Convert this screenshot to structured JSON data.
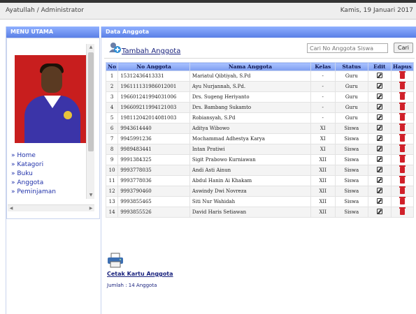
{
  "header": {
    "user": "Ayatullah / Administrator",
    "date": "Kamis, 19 Januari 2017"
  },
  "sidebar": {
    "title": "MENU UTAMA",
    "items": [
      {
        "label": "» Home"
      },
      {
        "label": "» Katagori"
      },
      {
        "label": "» Buku"
      },
      {
        "label": "» Anggota"
      },
      {
        "label": "» Peminjaman"
      }
    ]
  },
  "main": {
    "title": "Data Anggota",
    "add_label": "Tambah Anggota",
    "search": {
      "placeholder": "Cari No Anggota Siswa",
      "button": "Cari"
    },
    "columns": [
      "No",
      "No Anggota",
      "Nama Anggota",
      "Kelas",
      "Status",
      "Edit",
      "Hapus"
    ],
    "rows": [
      {
        "no": "1",
        "id": "15312436413331",
        "name": "Mariatul Qibtiyah, S.Pd",
        "kelas": "-",
        "status": "Guru"
      },
      {
        "no": "2",
        "id": "196111131986012001",
        "name": "Ayu Nurjannah, S.Pd.",
        "kelas": "-",
        "status": "Guru"
      },
      {
        "no": "3",
        "id": "196601241994031006",
        "name": "Drs. Sugeng Heriyanto",
        "kelas": "-",
        "status": "Guru"
      },
      {
        "no": "4",
        "id": "196609211994121003",
        "name": "Drs. Bambang Sukamto",
        "kelas": "-",
        "status": "Guru"
      },
      {
        "no": "5",
        "id": "198112042014081003",
        "name": "Robiansyah, S.Pd",
        "kelas": "-",
        "status": "Guru"
      },
      {
        "no": "6",
        "id": "9943614440",
        "name": "Aditya Wibowo",
        "kelas": "XI",
        "status": "Siswa"
      },
      {
        "no": "7",
        "id": "9945991236",
        "name": "Mochammad Adhestya Karya",
        "kelas": "XI",
        "status": "Siswa"
      },
      {
        "no": "8",
        "id": "9989483441",
        "name": "Intan Pratiwi",
        "kelas": "XI",
        "status": "Siswa"
      },
      {
        "no": "9",
        "id": "9991384325",
        "name": "Sigit Prabowo Kurniawan",
        "kelas": "XII",
        "status": "Siswa"
      },
      {
        "no": "10",
        "id": "9993778035",
        "name": "Andi Asti Ainun",
        "kelas": "XII",
        "status": "Siswa"
      },
      {
        "no": "11",
        "id": "9993778036",
        "name": "Abdul Hanin Ai Khakam",
        "kelas": "XII",
        "status": "Siswa"
      },
      {
        "no": "12",
        "id": "9993790460",
        "name": "Aswindy Dwi Novreza",
        "kelas": "XII",
        "status": "Siswa"
      },
      {
        "no": "13",
        "id": "9993855465",
        "name": "Siti Nur Wahidah",
        "kelas": "XII",
        "status": "Siswa"
      },
      {
        "no": "14",
        "id": "9993855526",
        "name": "David Haris Setiawan",
        "kelas": "XII",
        "status": "Siswa"
      }
    ],
    "print_label": "Cetak Kartu Anggota",
    "total_label": "Jumlah : 14 Anggota"
  },
  "colors": {
    "header_blue": "#6b8ef0",
    "link": "#1a237e",
    "trash": "#d0212a",
    "photo_bg": "#c81e1e"
  }
}
